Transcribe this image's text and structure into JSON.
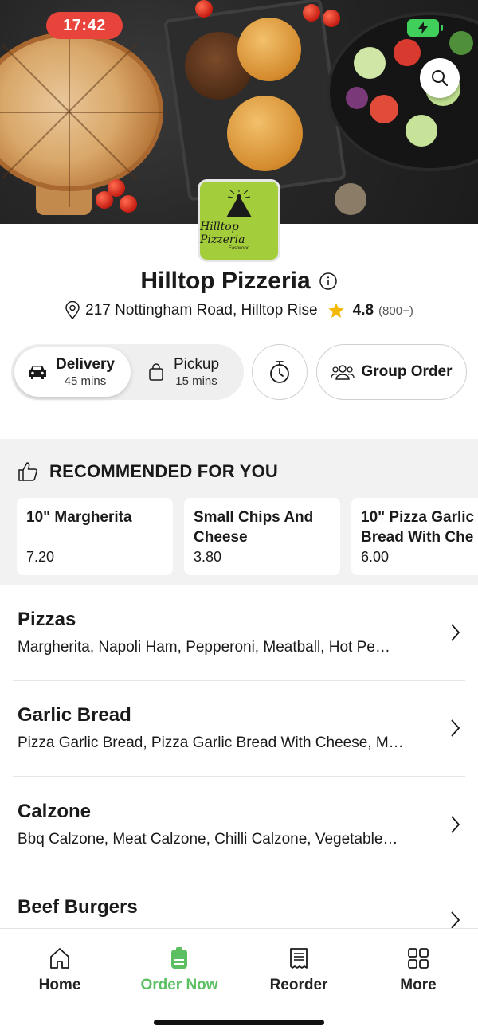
{
  "status_bar": {
    "time": "17:42",
    "battery_icon": "battery-charging-icon"
  },
  "restaurant": {
    "name": "Hilltop Pizzeria",
    "logo_text": "Hilltop Pizzeria",
    "logo_subtext": "Eastwood",
    "address": "217 Nottingham Road, Hilltop Rise",
    "rating": "4.8",
    "rating_count": "(800+)"
  },
  "order_mode": {
    "delivery": {
      "label": "Delivery",
      "time": "45 mins",
      "selected": true
    },
    "pickup": {
      "label": "Pickup",
      "time": "15 mins",
      "selected": false
    },
    "group_order_label": "Group Order"
  },
  "recommended": {
    "heading": "RECOMMENDED FOR YOU",
    "items": [
      {
        "name": "10\" Margherita",
        "price": "7.20"
      },
      {
        "name": "Small Chips And Cheese",
        "price": "3.80"
      },
      {
        "name": "10\" Pizza Garlic Bread With Che",
        "price": "6.00"
      }
    ]
  },
  "categories": [
    {
      "name": "Pizzas",
      "description": "Margherita, Napoli Ham, Pepperoni, Meatball, Hot Pe…"
    },
    {
      "name": "Garlic Bread",
      "description": "Pizza Garlic Bread, Pizza Garlic Bread With Cheese, M…"
    },
    {
      "name": "Calzone",
      "description": "Bbq Calzone, Meat Calzone, Chilli Calzone, Vegetable…"
    },
    {
      "name": "Beef Burgers",
      "description": ""
    }
  ],
  "bottom_nav": [
    {
      "label": "Home",
      "icon": "home-icon",
      "active": false
    },
    {
      "label": "Order Now",
      "icon": "order-icon",
      "active": true
    },
    {
      "label": "Reorder",
      "icon": "receipt-icon",
      "active": false
    },
    {
      "label": "More",
      "icon": "grid-icon",
      "active": false
    }
  ],
  "colors": {
    "accent_green": "#5cbf62",
    "time_pill": "#e8443b",
    "logo_bg": "#a3cd3a",
    "star": "#f5b800"
  }
}
